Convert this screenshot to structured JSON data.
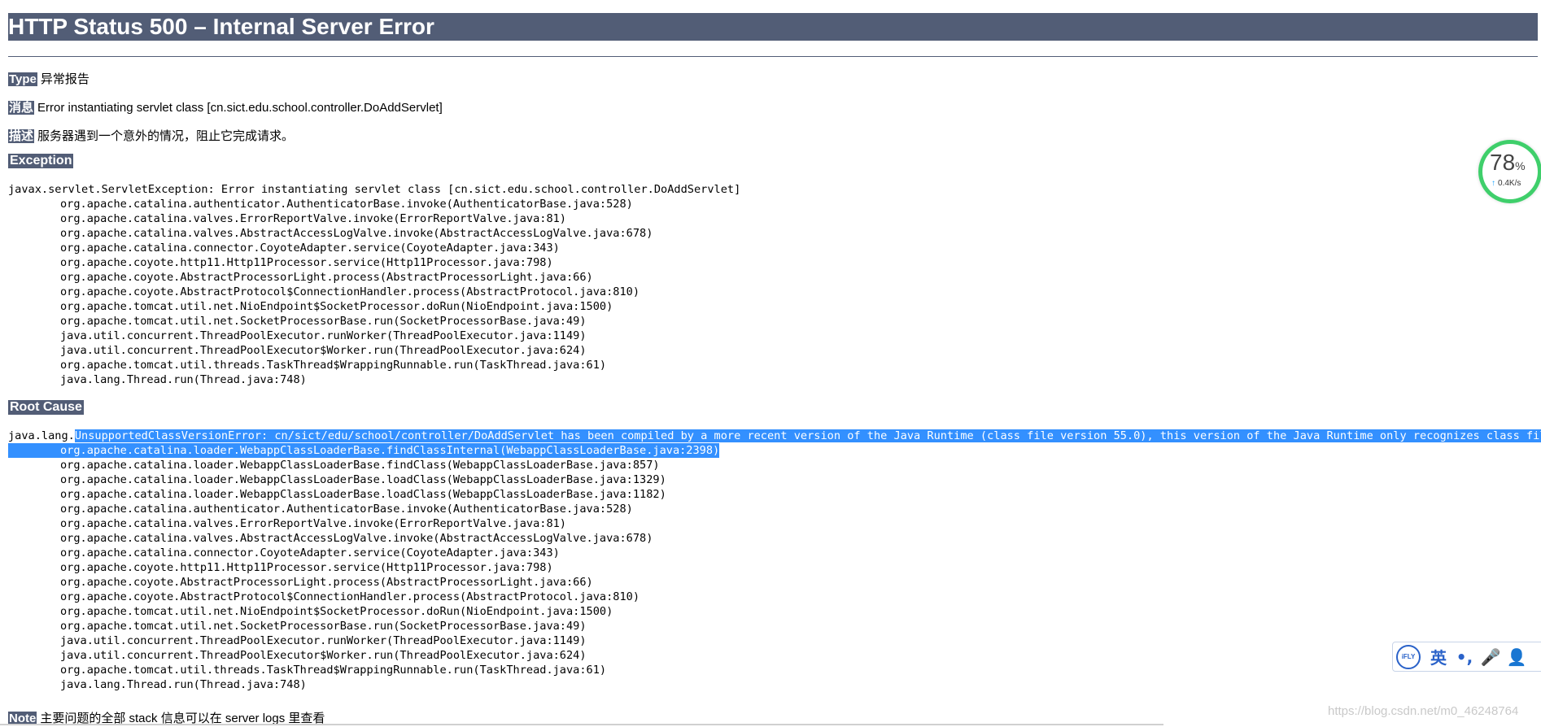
{
  "title": "HTTP Status 500 – Internal Server Error",
  "fields": {
    "type": {
      "label": "Type",
      "value": "异常报告"
    },
    "message": {
      "label": "消息",
      "value": "Error instantiating servlet class [cn.sict.edu.school.controller.DoAddServlet]"
    },
    "description": {
      "label": "描述",
      "value": "服务器遇到一个意外的情况，阻止它完成请求。"
    }
  },
  "exception": {
    "label": "Exception",
    "head": "javax.servlet.ServletException: Error instantiating servlet class [cn.sict.edu.school.controller.DoAddServlet]",
    "frames": [
      "org.apache.catalina.authenticator.AuthenticatorBase.invoke(AuthenticatorBase.java:528)",
      "org.apache.catalina.valves.ErrorReportValve.invoke(ErrorReportValve.java:81)",
      "org.apache.catalina.valves.AbstractAccessLogValve.invoke(AbstractAccessLogValve.java:678)",
      "org.apache.catalina.connector.CoyoteAdapter.service(CoyoteAdapter.java:343)",
      "org.apache.coyote.http11.Http11Processor.service(Http11Processor.java:798)",
      "org.apache.coyote.AbstractProcessorLight.process(AbstractProcessorLight.java:66)",
      "org.apache.coyote.AbstractProtocol$ConnectionHandler.process(AbstractProtocol.java:810)",
      "org.apache.tomcat.util.net.NioEndpoint$SocketProcessor.doRun(NioEndpoint.java:1500)",
      "org.apache.tomcat.util.net.SocketProcessorBase.run(SocketProcessorBase.java:49)",
      "java.util.concurrent.ThreadPoolExecutor.runWorker(ThreadPoolExecutor.java:1149)",
      "java.util.concurrent.ThreadPoolExecutor$Worker.run(ThreadPoolExecutor.java:624)",
      "org.apache.tomcat.util.threads.TaskThread$WrappingRunnable.run(TaskThread.java:61)",
      "java.lang.Thread.run(Thread.java:748)"
    ]
  },
  "root_cause": {
    "label": "Root Cause",
    "head_prefix": "java.lang.",
    "head_selected": "UnsupportedClassVersionError: cn/sict/edu/school/controller/DoAddServlet has been compiled by a more recent version of the Java Runtime (class file version 55.0), this version of the Java Runtime only recognizes class file ver",
    "selected_frame": "org.apache.catalina.loader.WebappClassLoaderBase.findClassInternal(WebappClassLoaderBase.java:2398)",
    "frames": [
      "org.apache.catalina.loader.WebappClassLoaderBase.findClass(WebappClassLoaderBase.java:857)",
      "org.apache.catalina.loader.WebappClassLoaderBase.loadClass(WebappClassLoaderBase.java:1329)",
      "org.apache.catalina.loader.WebappClassLoaderBase.loadClass(WebappClassLoaderBase.java:1182)",
      "org.apache.catalina.authenticator.AuthenticatorBase.invoke(AuthenticatorBase.java:528)",
      "org.apache.catalina.valves.ErrorReportValve.invoke(ErrorReportValve.java:81)",
      "org.apache.catalina.valves.AbstractAccessLogValve.invoke(AbstractAccessLogValve.java:678)",
      "org.apache.catalina.connector.CoyoteAdapter.service(CoyoteAdapter.java:343)",
      "org.apache.coyote.http11.Http11Processor.service(Http11Processor.java:798)",
      "org.apache.coyote.AbstractProcessorLight.process(AbstractProcessorLight.java:66)",
      "org.apache.coyote.AbstractProtocol$ConnectionHandler.process(AbstractProtocol.java:810)",
      "org.apache.tomcat.util.net.NioEndpoint$SocketProcessor.doRun(NioEndpoint.java:1500)",
      "org.apache.tomcat.util.net.SocketProcessorBase.run(SocketProcessorBase.java:49)",
      "java.util.concurrent.ThreadPoolExecutor.runWorker(ThreadPoolExecutor.java:1149)",
      "java.util.concurrent.ThreadPoolExecutor$Worker.run(ThreadPoolExecutor.java:624)",
      "org.apache.tomcat.util.threads.TaskThread$WrappingRunnable.run(TaskThread.java:61)",
      "java.lang.Thread.run(Thread.java:748)"
    ]
  },
  "note": {
    "label": "Note",
    "value": "主要问题的全部 stack 信息可以在 server logs 里查看"
  },
  "speed_widget": {
    "percent": "78",
    "percent_unit": "%",
    "rate": "0.4K/s",
    "ring_color": "#3fcf6b"
  },
  "ime_toolbar": {
    "logo": "iFLY",
    "lang": "英",
    "punct": "•,",
    "mic": "🎤",
    "user": "👤"
  },
  "watermark": "https://blog.csdn.net/m0_46248764"
}
